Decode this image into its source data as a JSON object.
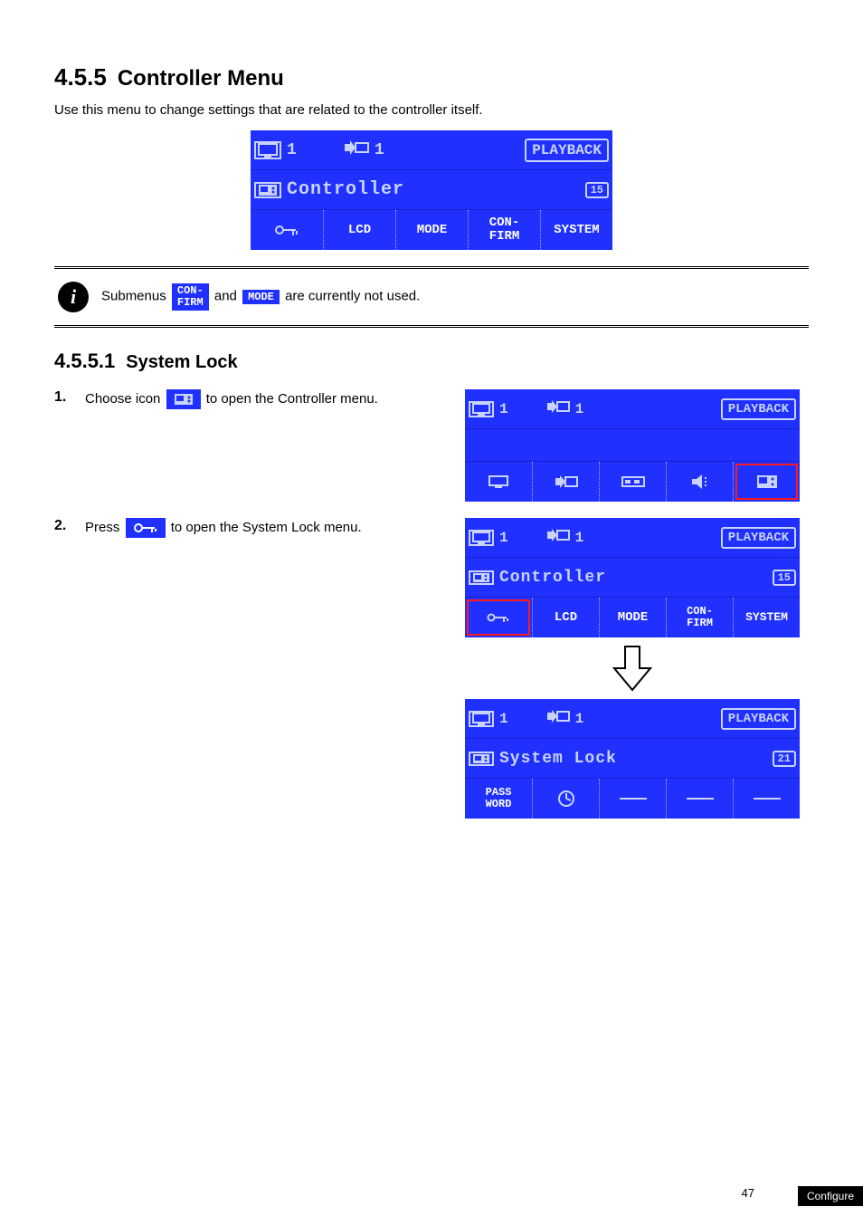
{
  "section": {
    "number": "4.5.5",
    "title": "Controller Menu"
  },
  "intro": "Use this menu to change settings that are related to the controller itself.",
  "screen_main": {
    "monitor": "1",
    "camera": "1",
    "mode": "PLAYBACK",
    "label": "Controller",
    "badge": "15",
    "tabs": [
      "",
      "LCD",
      "MODE",
      "CON-\nFIRM",
      "SYSTEM"
    ]
  },
  "note": {
    "pre": "Submenus",
    "chip1": "CON-\nFIRM",
    "mid": "and",
    "chip2": "MODE",
    "post": "are currently not used.",
    "info_label": "i"
  },
  "subsection": {
    "number": "4.5.5.1",
    "title": "System Lock"
  },
  "step1": {
    "num": "1.",
    "text_pre": "Choose icon",
    "text_post": "to open the Controller menu."
  },
  "step2": {
    "num": "2.",
    "text_pre": "Press",
    "text_post": "to open the System Lock menu."
  },
  "screen_step1": {
    "monitor": "1",
    "camera": "1",
    "mode": "PLAYBACK"
  },
  "screen_step2a": {
    "monitor": "1",
    "camera": "1",
    "mode": "PLAYBACK",
    "label": "Controller",
    "badge": "15",
    "tabs": [
      "",
      "LCD",
      "MODE",
      "CON-\nFIRM",
      "SYSTEM"
    ]
  },
  "screen_step2b": {
    "monitor": "1",
    "camera": "1",
    "mode": "PLAYBACK",
    "label": "System Lock",
    "badge": "21",
    "tabs": [
      "PASS\nWORD",
      "",
      "",
      "",
      ""
    ]
  },
  "footer": {
    "pagenum": "47",
    "tab": "Configure"
  }
}
